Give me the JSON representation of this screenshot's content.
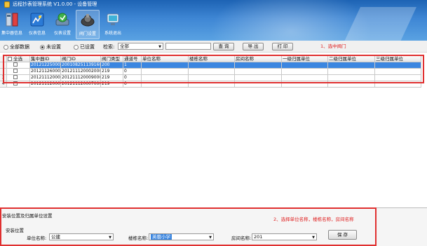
{
  "app": {
    "title": "远程抄表管理系统 V1.0.00 - 设备管理"
  },
  "toolbar": {
    "items": [
      {
        "label": "集中器信息",
        "icon": "concentrator-icon"
      },
      {
        "label": "仪表信息",
        "icon": "meter-info-icon"
      },
      {
        "label": "仪表设置",
        "icon": "meter-settings-icon"
      },
      {
        "label": "阀门设置",
        "icon": "valve-settings-icon"
      },
      {
        "label": "系统退出",
        "icon": "exit-icon"
      }
    ]
  },
  "filters": {
    "radios": [
      {
        "label": "全部数据",
        "checked": false
      },
      {
        "label": "未设置",
        "checked": true
      },
      {
        "label": "已设置",
        "checked": false
      }
    ],
    "search_label": "检索:",
    "search_value": "全部",
    "query_button": "查 询",
    "export_button": "导 出",
    "print_button": "打 印"
  },
  "grid": {
    "columns": [
      "全选",
      "集中器ID",
      "阀门ID",
      "阀门类型",
      "通道号",
      "单位名称",
      "楼栋名称",
      "房间名称",
      "一级归属单位",
      "二级归属单位",
      "三级归属单位"
    ],
    "rows": [
      {
        "num": "",
        "checked": false,
        "concentrator_id": "2012122500001",
        "valve_id": "2001082511391609",
        "valve_type": "200",
        "channel": "1",
        "unit": "",
        "building": "",
        "room": "",
        "lv1": "",
        "lv2": "",
        "lv3": "",
        "selected": true
      },
      {
        "num": "",
        "checked": false,
        "concentrator_id": "2012112600001",
        "valve_id": "2012111200020009",
        "valve_type": "219",
        "channel": "0",
        "unit": "",
        "building": "",
        "room": "",
        "lv1": "",
        "lv2": "",
        "lv3": "",
        "selected": false
      },
      {
        "num": "3",
        "checked": false,
        "concentrator_id": "2012111200009",
        "valve_id": "2012111200090000",
        "valve_type": "219",
        "channel": "0",
        "unit": "",
        "building": "",
        "room": "",
        "lv1": "",
        "lv2": "",
        "lv3": "",
        "selected": false
      },
      {
        "num": "4",
        "checked": false,
        "concentrator_id": "2012111200007",
        "valve_id": "2012111200070000",
        "valve_type": "219",
        "channel": "0",
        "unit": "",
        "building": "",
        "room": "",
        "lv1": "",
        "lv2": "",
        "lv3": "",
        "selected": false
      }
    ]
  },
  "bottom": {
    "title": "安装位置及归属单位设置",
    "group_label": "安装位置",
    "unit_label": "单位名称:",
    "unit_value": "公建",
    "building_label": "楼栋名称:",
    "building_value": "英蓉小学",
    "room_label": "房间名称:",
    "room_value": "201",
    "save_button": "保 存"
  },
  "annotations": {
    "step1": "1、选中阀门",
    "step2": "2、选择单位名称，楼栋名称，房间名称"
  },
  "colors": {
    "header_blue": "#2f74c4",
    "selection_blue": "#3b86e0",
    "annotation_red": "#e03030"
  }
}
